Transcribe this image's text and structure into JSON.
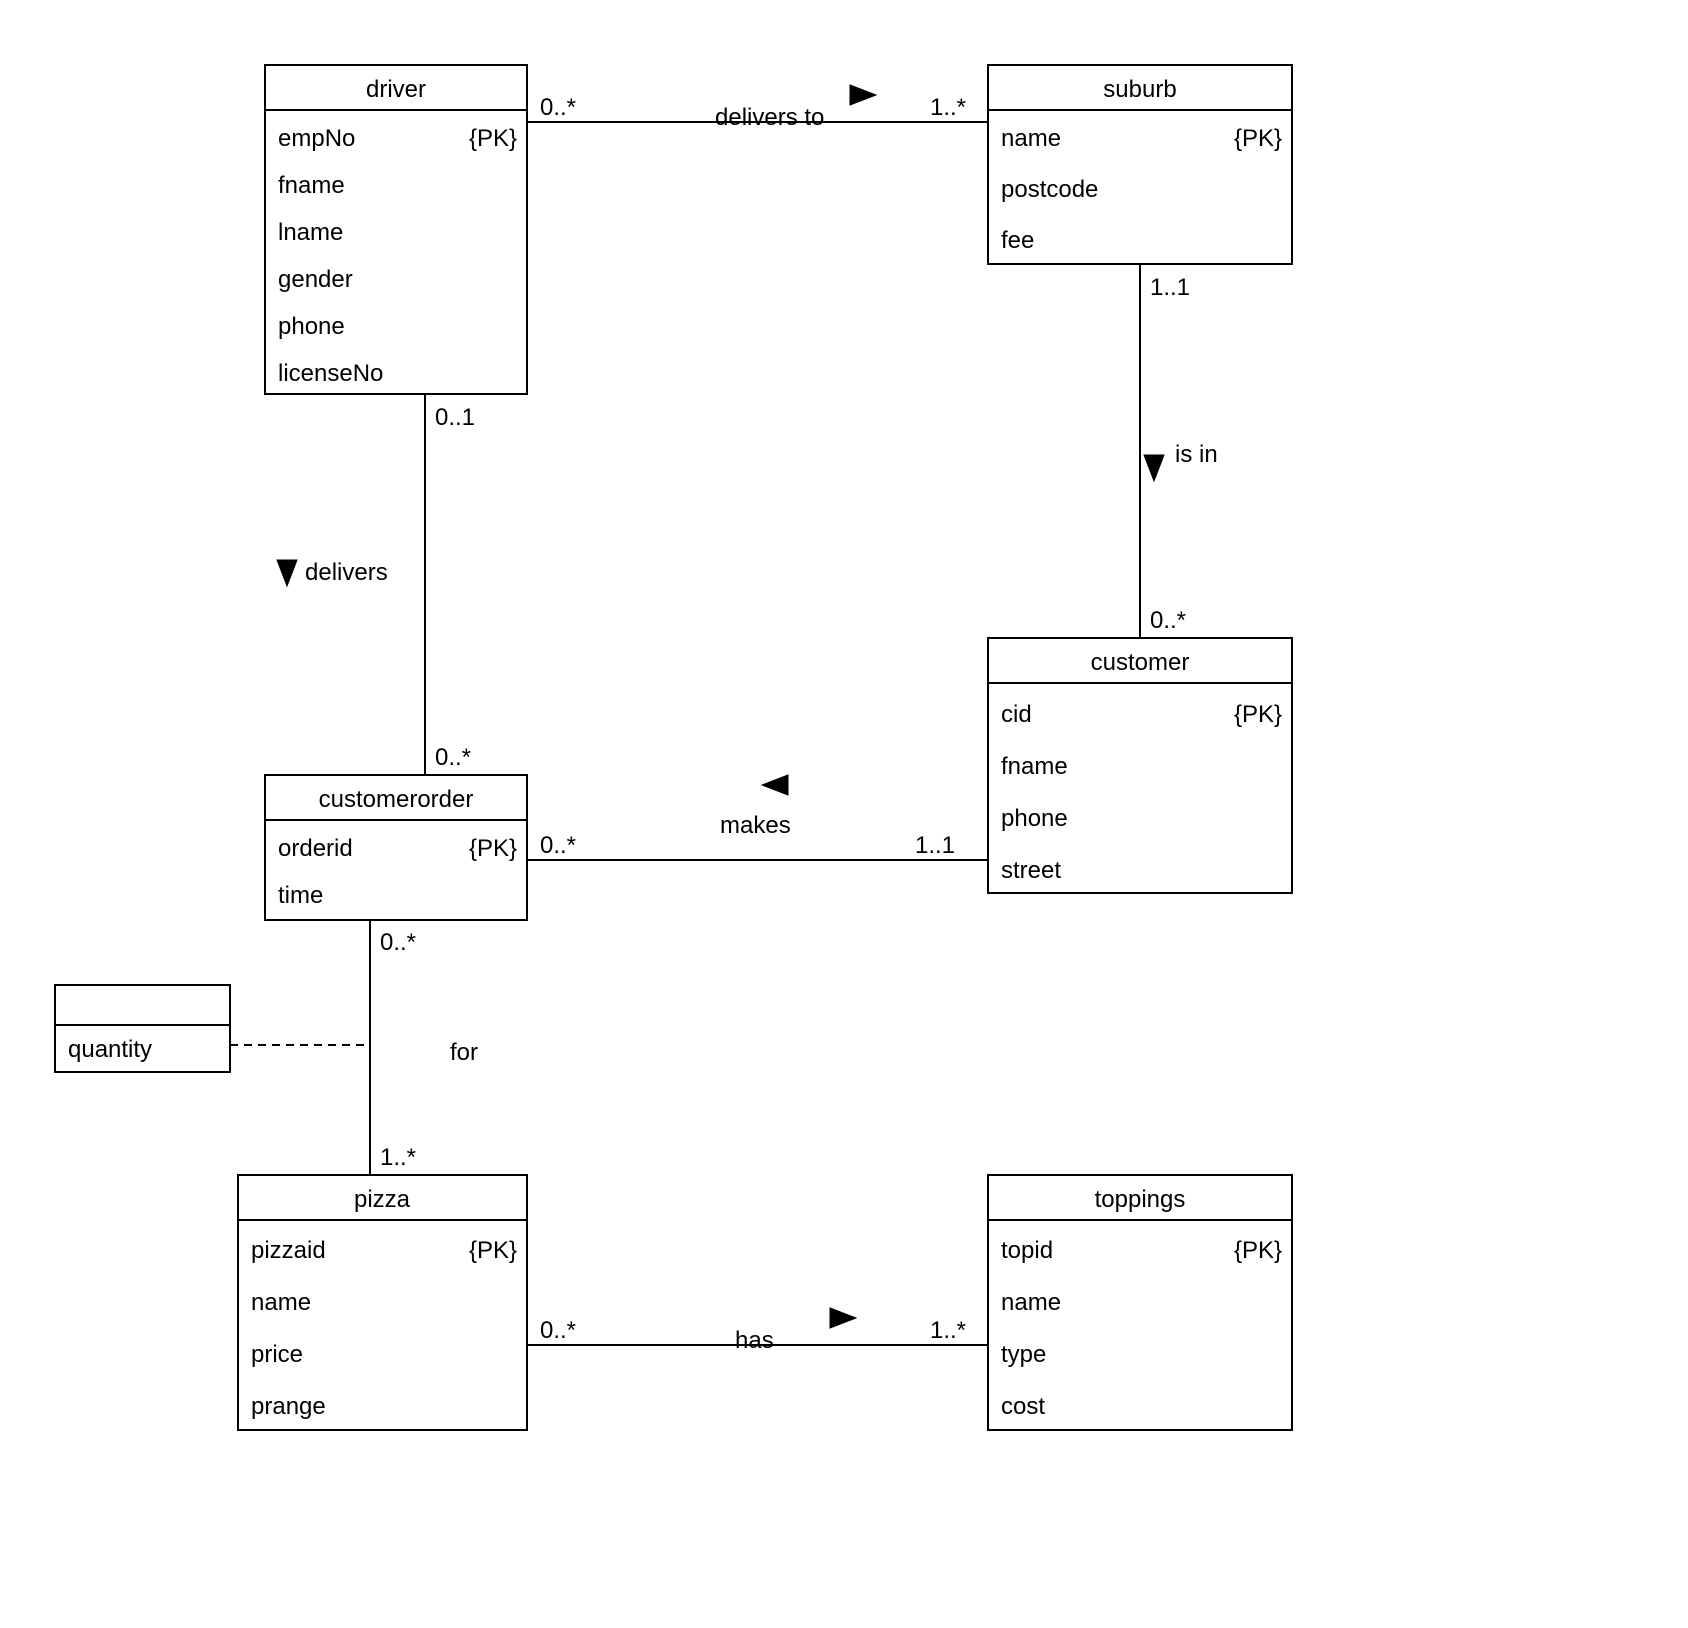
{
  "pk_tag": "{PK}",
  "entities": {
    "driver": {
      "title": "driver",
      "attrs": [
        "empNo",
        "fname",
        "lname",
        "gender",
        "phone",
        "licenseNo"
      ]
    },
    "suburb": {
      "title": "suburb",
      "attrs": [
        "name",
        "postcode",
        "fee"
      ]
    },
    "customerorder": {
      "title": "customerorder",
      "attrs": [
        "orderid",
        "time"
      ]
    },
    "customer": {
      "title": "customer",
      "attrs": [
        "cid",
        "fname",
        "phone",
        "street"
      ]
    },
    "assoc": {
      "title": "",
      "attrs": [
        "quantity"
      ]
    },
    "pizza": {
      "title": "pizza",
      "attrs": [
        "pizzaid",
        "name",
        "price",
        "prange"
      ]
    },
    "toppings": {
      "title": "toppings",
      "attrs": [
        "topid",
        "name",
        "type",
        "cost"
      ]
    }
  },
  "rel": {
    "delivers_to": {
      "label": "delivers to",
      "m1": "0..*",
      "m2": "1..*"
    },
    "is_in": {
      "label": "is in",
      "m1": "1..1",
      "m2": "0..*"
    },
    "delivers": {
      "label": "delivers",
      "m1": "0..1",
      "m2": "0..*"
    },
    "makes": {
      "label": "makes",
      "m1": "0..*",
      "m2": "1..1"
    },
    "for": {
      "label": "for",
      "m1": "0..*",
      "m2": "1..*"
    },
    "has": {
      "label": "has",
      "m1": "0..*",
      "m2": "1..*"
    }
  }
}
